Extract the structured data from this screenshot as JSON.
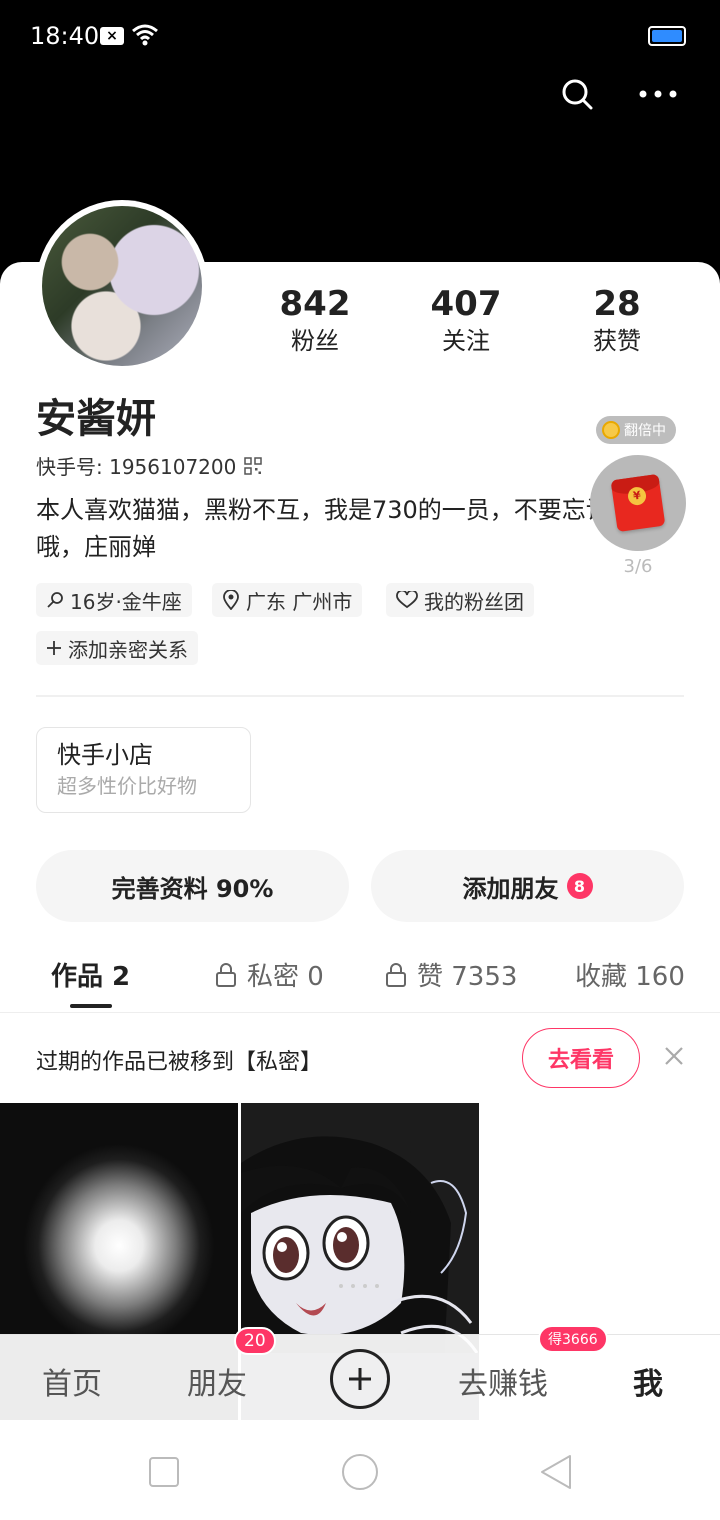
{
  "status_bar": {
    "time": "18:40",
    "x_badge": "×"
  },
  "profile": {
    "name": "安酱妍",
    "kuaishou_id": "快手号: 1956107200",
    "bio": "本人喜欢猫猫，黑粉不互，我是730的一员，不要忘记我哦，庄丽婵",
    "stats": [
      {
        "value": "842",
        "label": "粉丝"
      },
      {
        "value": "407",
        "label": "关注"
      },
      {
        "value": "28",
        "label": "获赞"
      }
    ],
    "tags": {
      "age_sign": "16岁·金牛座",
      "location": "广东 广州市",
      "fan_club": "我的粉丝团",
      "add_relation": "添加亲密关系"
    }
  },
  "red_packet": {
    "badge": "翻倍中",
    "progress": "3/6"
  },
  "shop": {
    "title": "快手小店",
    "subtitle": "超多性价比好物"
  },
  "actions": {
    "complete_profile": "完善资料 90%",
    "add_friends": "添加朋友",
    "add_friends_count": "8"
  },
  "tabs": [
    {
      "label": "作品 2"
    },
    {
      "label": "私密 0"
    },
    {
      "label": "赞 7353"
    },
    {
      "label": "收藏 160"
    }
  ],
  "notice": {
    "text": "过期的作品已被移到【私密】",
    "button": "去看看"
  },
  "bottom_nav": {
    "home": "首页",
    "friends": "朋友",
    "friends_badge": "20",
    "earn": "去赚钱",
    "earn_badge": "得3666",
    "me": "我"
  },
  "colors": {
    "accent": "#fe3666",
    "battery": "#2f8cff"
  }
}
